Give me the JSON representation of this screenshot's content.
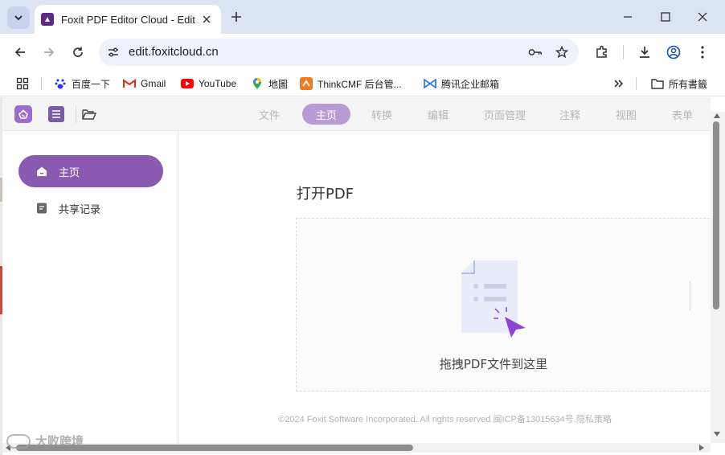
{
  "browser": {
    "tab_title": "Foxit PDF Editor Cloud - Edit",
    "url": "edit.foxitcloud.cn",
    "bookmarks": [
      {
        "label": "百度一下",
        "icon": "baidu-icon"
      },
      {
        "label": "Gmail",
        "icon": "gmail-icon"
      },
      {
        "label": "YouTube",
        "icon": "youtube-icon"
      },
      {
        "label": "地圖",
        "icon": "maps-icon"
      },
      {
        "label": "ThinkCMF 后台管...",
        "icon": "thinkcmf-icon"
      },
      {
        "label": "腾讯企业邮箱",
        "icon": "tencent-mail-icon"
      }
    ],
    "all_bookmarks_label": "所有書籤"
  },
  "app": {
    "tabs": [
      {
        "label": "文件",
        "active": false
      },
      {
        "label": "主页",
        "active": true
      },
      {
        "label": "转换",
        "active": false
      },
      {
        "label": "编辑",
        "active": false
      },
      {
        "label": "页面管理",
        "active": false
      },
      {
        "label": "注释",
        "active": false
      },
      {
        "label": "视图",
        "active": false
      },
      {
        "label": "表单",
        "active": false
      }
    ],
    "sidebar": {
      "items": [
        {
          "label": "主页",
          "icon": "home-icon",
          "active": true
        },
        {
          "label": "共享记录",
          "icon": "document-icon",
          "active": false
        }
      ]
    },
    "main": {
      "open_title": "打开PDF",
      "drop_text": "拖拽PDF文件到这里",
      "footer": "©2024 Foxit Software Incorporated. All rights reserved.闽ICP备13015634号.隐私策略"
    }
  },
  "watermark": "大败跨境",
  "colors": {
    "accent": "#8a5ab1",
    "accent_light": "#b89bd3",
    "brand_dark": "#5e2a8a"
  }
}
